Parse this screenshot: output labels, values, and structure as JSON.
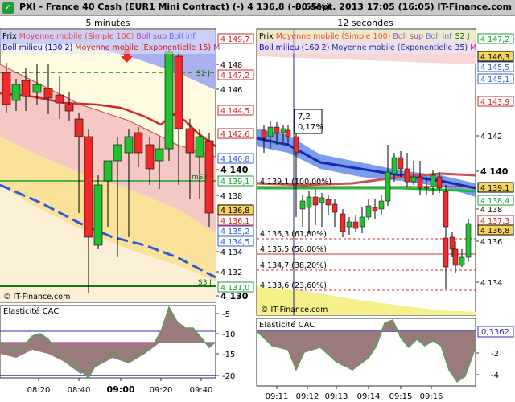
{
  "titlebar": {
    "app": "PXI",
    "instrument": "France 40 Cash (EUR1 Mini Contract) (-)",
    "price": "4 136,8 (-0,65%)",
    "datetime": "30 sept. 2013 17:05 (16:05)",
    "site": "IT-Finance.com"
  },
  "left_panel": {
    "title": "5 minutes",
    "legend_line1": [
      "Prix",
      "Moyenne mobile (Simple 100)",
      "Boll sup",
      "Boll inf"
    ],
    "legend_line2": [
      "Boll milieu (130 2)",
      "Moyenne mobile (Exponentielle 15)",
      "M"
    ],
    "watermark": "© IT-Finance.com",
    "price_labels": [
      "4 149,7",
      "4 148",
      "4 147,2",
      "4 146",
      "4 144,5",
      "4 142,6",
      "4 142",
      "4 140,8",
      "4 140",
      "4 139,1",
      "4 138",
      "4 136,8",
      "4 136,1",
      "4 135,2",
      "4 134,5",
      "4 134",
      "4 132",
      "4 131,0",
      "4 130"
    ],
    "level_tags": [
      "S2 J",
      "mS3",
      "S3 J"
    ],
    "subchart_title": "Elasticité CAC",
    "subchart_labels": [
      "-5",
      "-10",
      "-15",
      "-20"
    ],
    "time_labels": [
      "08:20",
      "08:40",
      "09:00",
      "09:20",
      "09:40"
    ]
  },
  "right_panel": {
    "title": "12 secondes",
    "legend_line1": [
      "Prix",
      "Moyenne mobile (Simple 100)",
      "Boll sup",
      "Boll inf",
      "S2 J"
    ],
    "legend_line2": [
      "Boll milieu (160 2)",
      "Moyenne mobile (Exponentielle 35)",
      "M"
    ],
    "watermark": "© IT-Finance.com",
    "price_labels": [
      "4 147,2",
      "4 146,3",
      "4 145,5",
      "4 145,1",
      "4 143,9",
      "4 142",
      "4 140",
      "4 139,1",
      "4 138,4",
      "4 138",
      "4 137,3",
      "4 136,8",
      "4 136",
      "4 134"
    ],
    "tooltip": [
      "7,2",
      "0,17%"
    ],
    "fib_labels": [
      "4 139,1 (100,00%)",
      "4 136,3 (61,80%)",
      "4 135,5 (50,00%)",
      "4 134,7 (38,20%)",
      "4 133,6 (23,60%)"
    ],
    "subchart_title": "Elasticité CAC",
    "subchart_labels": [
      "0,3362",
      "-2",
      "-4"
    ],
    "time_labels": [
      "09:11",
      "09:12",
      "09:13",
      "09:14",
      "09:15",
      "09:16"
    ]
  },
  "colors": {
    "up_candle": "#22c032",
    "down_candle": "#ee2a2a",
    "boll_band": "#3c6ee6",
    "moving_avg": "#d02828",
    "accent_green": "#18a030",
    "elasticity_fill": "#9a7a7a"
  }
}
